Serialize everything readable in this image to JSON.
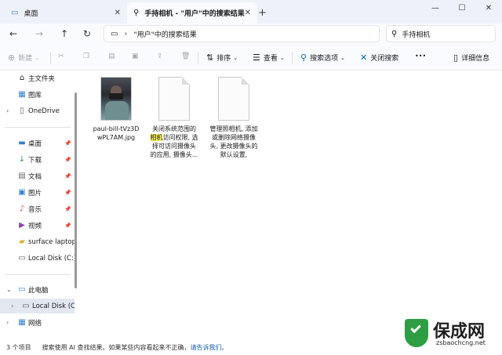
{
  "tabs": [
    {
      "title": "桌面",
      "active": false,
      "icon": "desktop-icon"
    },
    {
      "title": "手持相机 - \"用户\"中的搜索结果",
      "active": true,
      "icon": "search-icon"
    }
  ],
  "window_controls": {
    "minimize": "—",
    "maximize": "☐",
    "close": "✕"
  },
  "address": {
    "path": "\"用户\"中的搜索结果"
  },
  "search": {
    "query": "手持相机"
  },
  "commands": {
    "new": "新建",
    "sort": "排序",
    "view": "查看",
    "search_options": "搜索选项",
    "close_search": "关闭搜索",
    "more": "•••",
    "details": "详细信息"
  },
  "sidebar": {
    "top": [
      {
        "label": "主文件夹",
        "icon": "home-icon"
      },
      {
        "label": "图库",
        "icon": "gallery-icon"
      },
      {
        "label": "OneDrive",
        "icon": "document-icon",
        "expandable": true
      }
    ],
    "pinned": [
      {
        "label": "桌面",
        "icon": "desktop-folder-icon"
      },
      {
        "label": "下载",
        "icon": "download-icon"
      },
      {
        "label": "文档",
        "icon": "documents-icon"
      },
      {
        "label": "图片",
        "icon": "pictures-icon"
      },
      {
        "label": "音乐",
        "icon": "music-icon"
      },
      {
        "label": "视频",
        "icon": "videos-icon"
      },
      {
        "label": "surface laptop",
        "icon": "folder-icon"
      },
      {
        "label": "Local Disk (C:)",
        "icon": "drive-icon"
      }
    ],
    "this_pc": {
      "label": "此电脑",
      "child": "Local Disk (C:)"
    },
    "network": {
      "label": "网络"
    }
  },
  "results": [
    {
      "type": "image",
      "name_lines": [
        "paul-bill-tVz3D",
        "wPL7AM.jpg"
      ]
    },
    {
      "type": "document",
      "line1": "关闭系统范围的",
      "line2_highlight": "相机",
      "line2_rest": "访问权限, 选",
      "line3": "择可访问摄像头",
      "line4": "的应用, 摄像头..."
    },
    {
      "type": "document",
      "lines": [
        "管理照相机, 添加",
        "或删除网络摄像",
        "头, 更改摄像头的",
        "默认设置,"
      ]
    }
  ],
  "status": {
    "count": "3 个项目",
    "notice": "搜索使用 AI 查找结果。如果某些内容看起来不正确，",
    "feedback": "请告诉我们。"
  },
  "watermark": {
    "brand": "保成网",
    "url": "zsbaochcng.net"
  },
  "colors": {
    "accent": "#0067c0",
    "highlight": "#fff35c",
    "logo_green": "#2e9e45"
  }
}
